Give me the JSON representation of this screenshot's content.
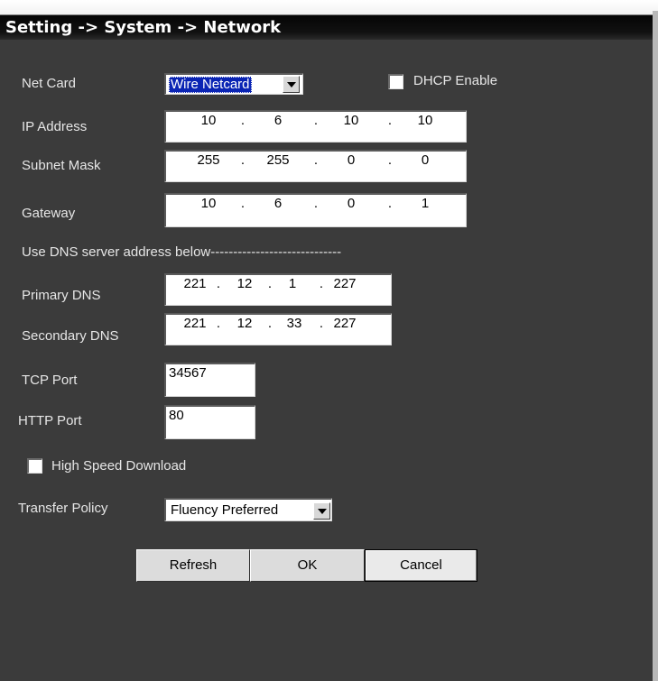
{
  "title": "Setting -> System -> Network",
  "net_card": {
    "label": "Net Card",
    "value": "Wire Netcard"
  },
  "dhcp": {
    "label": "DHCP Enable",
    "checked": false
  },
  "ip_address": {
    "label": "IP Address",
    "octets": [
      "10",
      "6",
      "10",
      "10"
    ]
  },
  "subnet_mask": {
    "label": "Subnet Mask",
    "octets": [
      "255",
      "255",
      "0",
      "0"
    ]
  },
  "gateway": {
    "label": "Gateway",
    "octets": [
      "10",
      "6",
      "0",
      "1"
    ]
  },
  "dns_header": "Use DNS server address below-----------------------------",
  "primary_dns": {
    "label": "Primary DNS",
    "octets": [
      "221",
      "12",
      "1",
      "227"
    ]
  },
  "secondary_dns": {
    "label": "Secondary DNS",
    "octets": [
      "221",
      "12",
      "33",
      "227"
    ]
  },
  "tcp_port": {
    "label": "TCP Port",
    "value": "34567"
  },
  "http_port": {
    "label": "HTTP Port",
    "value": "80"
  },
  "high_speed": {
    "label": "High Speed Download",
    "checked": false
  },
  "transfer_policy": {
    "label": "Transfer Policy",
    "value": "Fluency Preferred"
  },
  "buttons": {
    "refresh": "Refresh",
    "ok": "OK",
    "cancel": "Cancel"
  },
  "dot": "."
}
